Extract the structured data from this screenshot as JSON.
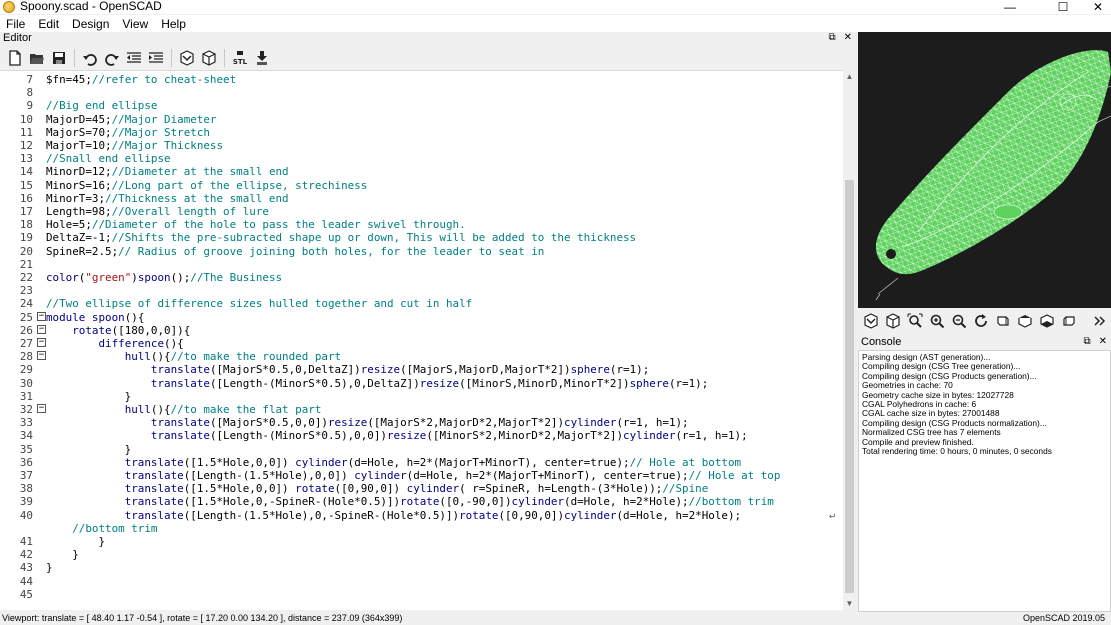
{
  "window": {
    "title": "Spoony.scad - OpenSCAD",
    "minimize": "—",
    "maximize": "☐",
    "close": "✕"
  },
  "menu": [
    "File",
    "Edit",
    "Design",
    "View",
    "Help"
  ],
  "editor": {
    "title": "Editor",
    "float_glyph": "⧉",
    "close_glyph": "✕",
    "lines": [
      {
        "n": "7",
        "parts": [
          [
            "c",
            "$fn=45;"
          ],
          [
            "cmt",
            "//refer to cheat-sheet"
          ]
        ]
      },
      {
        "n": "8",
        "parts": []
      },
      {
        "n": "9",
        "parts": [
          [
            "cmt",
            "//Big end ellipse"
          ]
        ]
      },
      {
        "n": "10",
        "parts": [
          [
            "c",
            "MajorD=45;"
          ],
          [
            "cmt",
            "//Major Diameter"
          ]
        ]
      },
      {
        "n": "11",
        "parts": [
          [
            "c",
            "MajorS=70;"
          ],
          [
            "cmt",
            "//Major Stretch"
          ]
        ]
      },
      {
        "n": "12",
        "parts": [
          [
            "c",
            "MajorT=10;"
          ],
          [
            "cmt",
            "//Major Thickness"
          ]
        ]
      },
      {
        "n": "13",
        "parts": [
          [
            "cmt",
            "//Snall end ellipse"
          ]
        ]
      },
      {
        "n": "14",
        "parts": [
          [
            "c",
            "MinorD=12;"
          ],
          [
            "cmt",
            "//Diameter at the small end"
          ]
        ]
      },
      {
        "n": "15",
        "parts": [
          [
            "c",
            "MinorS=16;"
          ],
          [
            "cmt",
            "//Long part of the ellipse, strechiness"
          ]
        ]
      },
      {
        "n": "16",
        "parts": [
          [
            "c",
            "MinorT=3;"
          ],
          [
            "cmt",
            "//Thickness at the small end"
          ]
        ]
      },
      {
        "n": "17",
        "parts": [
          [
            "c",
            "Length=98;"
          ],
          [
            "cmt",
            "//Overall length of lure"
          ]
        ]
      },
      {
        "n": "18",
        "parts": [
          [
            "c",
            "Hole=5;"
          ],
          [
            "cmt",
            "//Diameter of the hole to pass the leader swivel through."
          ]
        ]
      },
      {
        "n": "19",
        "parts": [
          [
            "c",
            "DeltaZ=-1;"
          ],
          [
            "cmt",
            "//Shifts the pre-subracted shape up or down, This will be added to the thickness"
          ]
        ]
      },
      {
        "n": "20",
        "parts": [
          [
            "c",
            "SpineR=2.5;"
          ],
          [
            "cmt",
            "// Radius of groove joining both holes, for the leader to seat in"
          ]
        ]
      },
      {
        "n": "21",
        "parts": []
      },
      {
        "n": "22",
        "parts": [
          [
            "kw",
            "color"
          ],
          [
            "c",
            "("
          ],
          [
            "str",
            "\"green\""
          ],
          [
            "c",
            ")"
          ],
          [
            "kw",
            "spoon"
          ],
          [
            "c",
            "();"
          ],
          [
            "cmt",
            "//The Business"
          ]
        ]
      },
      {
        "n": "23",
        "parts": []
      },
      {
        "n": "24",
        "parts": [
          [
            "cmt",
            "//Two ellipse of difference sizes hulled together and cut in half"
          ]
        ]
      },
      {
        "n": "25",
        "fold": true,
        "parts": [
          [
            "kw",
            "module"
          ],
          [
            "c",
            " "
          ],
          [
            "kw",
            "spoon"
          ],
          [
            "c",
            "(){"
          ]
        ]
      },
      {
        "n": "26",
        "fold": true,
        "parts": [
          [
            "c",
            "    "
          ],
          [
            "kw",
            "rotate"
          ],
          [
            "c",
            "([180,0,0]){"
          ]
        ]
      },
      {
        "n": "27",
        "fold": true,
        "parts": [
          [
            "c",
            "        "
          ],
          [
            "kw",
            "difference"
          ],
          [
            "c",
            "(){"
          ]
        ]
      },
      {
        "n": "28",
        "fold": true,
        "parts": [
          [
            "c",
            "            "
          ],
          [
            "kw",
            "hull"
          ],
          [
            "c",
            "(){"
          ],
          [
            "cmt",
            "//to make the rounded part"
          ]
        ]
      },
      {
        "n": "29",
        "parts": [
          [
            "c",
            "                "
          ],
          [
            "kw",
            "translate"
          ],
          [
            "c",
            "([MajorS*0.5,0,DeltaZ])"
          ],
          [
            "kw",
            "resize"
          ],
          [
            "c",
            "([MajorS,MajorD,MajorT*2])"
          ],
          [
            "kw",
            "sphere"
          ],
          [
            "c",
            "(r=1);"
          ]
        ]
      },
      {
        "n": "30",
        "parts": [
          [
            "c",
            "                "
          ],
          [
            "kw",
            "translate"
          ],
          [
            "c",
            "([Length-(MinorS*0.5),0,DeltaZ])"
          ],
          [
            "kw",
            "resize"
          ],
          [
            "c",
            "([MinorS,MinorD,MinorT*2])"
          ],
          [
            "kw",
            "sphere"
          ],
          [
            "c",
            "(r=1);"
          ]
        ]
      },
      {
        "n": "31",
        "parts": [
          [
            "c",
            "            }"
          ]
        ]
      },
      {
        "n": "32",
        "fold": true,
        "parts": [
          [
            "c",
            "            "
          ],
          [
            "kw",
            "hull"
          ],
          [
            "c",
            "(){"
          ],
          [
            "cmt",
            "//to make the flat part"
          ]
        ]
      },
      {
        "n": "33",
        "parts": [
          [
            "c",
            "                "
          ],
          [
            "kw",
            "translate"
          ],
          [
            "c",
            "([MajorS*0.5,0,0])"
          ],
          [
            "kw",
            "resize"
          ],
          [
            "c",
            "([MajorS*2,MajorD*2,MajorT*2])"
          ],
          [
            "kw",
            "cylinder"
          ],
          [
            "c",
            "(r=1, h=1);"
          ]
        ]
      },
      {
        "n": "34",
        "parts": [
          [
            "c",
            "                "
          ],
          [
            "kw",
            "translate"
          ],
          [
            "c",
            "([Length-(MinorS*0.5),0,0])"
          ],
          [
            "kw",
            "resize"
          ],
          [
            "c",
            "([MinorS*2,MinorD*2,MajorT*2])"
          ],
          [
            "kw",
            "cylinder"
          ],
          [
            "c",
            "(r=1, h=1);"
          ]
        ]
      },
      {
        "n": "35",
        "parts": [
          [
            "c",
            "            }"
          ]
        ]
      },
      {
        "n": "36",
        "parts": [
          [
            "c",
            "            "
          ],
          [
            "kw",
            "translate"
          ],
          [
            "c",
            "([1.5*Hole,0,0]) "
          ],
          [
            "kw",
            "cylinder"
          ],
          [
            "c",
            "(d=Hole, h=2*(MajorT+MinorT), center=true);"
          ],
          [
            "cmt",
            "// Hole at bottom"
          ]
        ]
      },
      {
        "n": "37",
        "parts": [
          [
            "c",
            "            "
          ],
          [
            "kw",
            "translate"
          ],
          [
            "c",
            "([Length-(1.5*Hole),0,0]) "
          ],
          [
            "kw",
            "cylinder"
          ],
          [
            "c",
            "(d=Hole, h=2*(MajorT+MinorT), center=true);"
          ],
          [
            "cmt",
            "// Hole at top"
          ]
        ]
      },
      {
        "n": "38",
        "parts": [
          [
            "c",
            "            "
          ],
          [
            "kw",
            "translate"
          ],
          [
            "c",
            "([1.5*Hole,0,0]) "
          ],
          [
            "kw",
            "rotate"
          ],
          [
            "c",
            "([0,90,0]) "
          ],
          [
            "kw",
            "cylinder"
          ],
          [
            "c",
            "( r=SpineR, h=Length-(3*Hole));"
          ],
          [
            "cmt",
            "//Spine"
          ]
        ]
      },
      {
        "n": "39",
        "parts": [
          [
            "c",
            "            "
          ],
          [
            "kw",
            "translate"
          ],
          [
            "c",
            "([1.5*Hole,0,-SpineR-(Hole*0.5)])"
          ],
          [
            "kw",
            "rotate"
          ],
          [
            "c",
            "([0,-90,0])"
          ],
          [
            "kw",
            "cylinder"
          ],
          [
            "c",
            "(d=Hole, h=2*Hole);"
          ],
          [
            "cmt",
            "//bottom trim"
          ]
        ]
      },
      {
        "n": "40",
        "wrap": true,
        "parts": [
          [
            "c",
            "            "
          ],
          [
            "kw",
            "translate"
          ],
          [
            "c",
            "([Length-(1.5*Hole),0,-SpineR-(Hole*0.5)])"
          ],
          [
            "kw",
            "rotate"
          ],
          [
            "c",
            "([0,90,0])"
          ],
          [
            "kw",
            "cylinder"
          ],
          [
            "c",
            "(d=Hole, h=2*Hole);"
          ]
        ]
      },
      {
        "n": "",
        "parts": [
          [
            "c",
            "    "
          ],
          [
            "cmt",
            "//bottom trim"
          ]
        ]
      },
      {
        "n": "41",
        "parts": [
          [
            "c",
            "        }"
          ]
        ]
      },
      {
        "n": "42",
        "parts": [
          [
            "c",
            "    }"
          ]
        ]
      },
      {
        "n": "43",
        "parts": [
          [
            "c",
            "}"
          ]
        ]
      },
      {
        "n": "44",
        "parts": []
      },
      {
        "n": "45",
        "parts": []
      }
    ]
  },
  "console": {
    "title": "Console",
    "float_glyph": "⧉",
    "close_glyph": "✕",
    "lines": [
      "Parsing design (AST generation)...",
      "Compiling design (CSG Tree generation)...",
      "Compiling design (CSG Products generation)...",
      "Geometries in cache: 70",
      "Geometry cache size in bytes: 12027728",
      "CGAL Polyhedrons in cache: 6",
      "CGAL cache size in bytes: 27001488",
      "Compiling design (CSG Products normalization)...",
      "Normalized CSG tree has 7 elements",
      "Compile and preview finished.",
      "Total rendering time: 0 hours, 0 minutes, 0 seconds"
    ]
  },
  "status": {
    "viewport": "Viewport: translate = [ 48.40 1.17 -0.54 ], rotate = [ 17.20 0.00 134.20 ], distance = 237.09 (364x399)",
    "version": "OpenSCAD 2019.05"
  },
  "colors": {
    "model": "#5fd15f",
    "viewport_bg": "#1c1c1c",
    "comment": "#008080",
    "keyword": "#000080",
    "string": "#a31515"
  },
  "icons": {
    "editor_toolbar": [
      "new-file-icon",
      "open-file-icon",
      "save-icon",
      "undo-icon",
      "redo-icon",
      "unindent-icon",
      "indent-icon",
      "preview-icon",
      "render-icon",
      "export-stl-icon",
      "send-to-print-icon"
    ],
    "view_toolbar": [
      "preview-icon",
      "render-icon",
      "view-all-icon",
      "zoom-in-icon",
      "zoom-out-icon",
      "reset-view-icon",
      "view-right-icon",
      "view-top-icon",
      "view-bottom-icon",
      "view-left-icon",
      "more-icon"
    ]
  }
}
